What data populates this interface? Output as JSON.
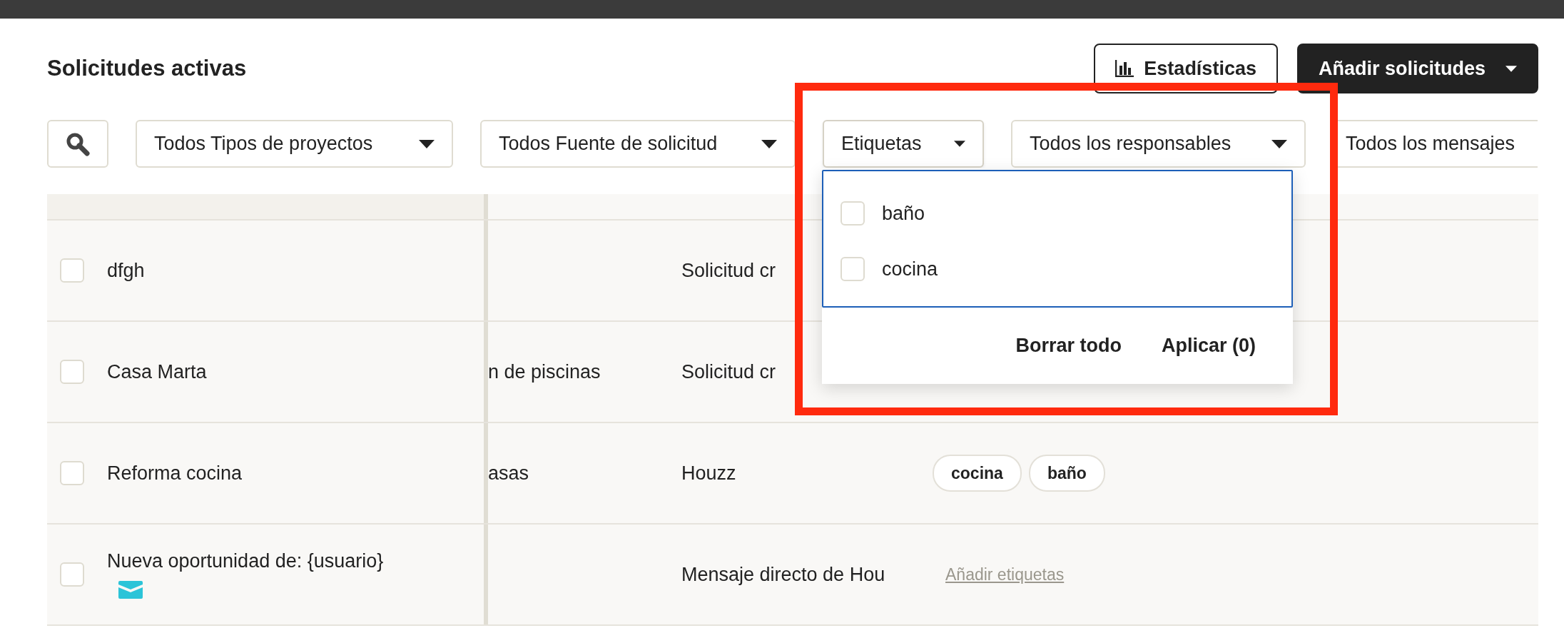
{
  "header": {
    "title": "Solicitudes activas",
    "buttons": [
      {
        "kind": "outline",
        "label": "Estadísticas"
      },
      {
        "kind": "dark",
        "label": "Añadir solicitudes"
      }
    ]
  },
  "filters": [
    {
      "kind": "search"
    },
    {
      "kind": "select",
      "label": "Todos Tipos de proyectos",
      "open": false
    },
    {
      "kind": "select",
      "label": "Todos Fuente de solicitud",
      "open": false
    },
    {
      "kind": "select",
      "label": "Etiquetas",
      "open": true
    },
    {
      "kind": "select",
      "label": "Todos los responsables",
      "open": false
    },
    {
      "kind": "cut",
      "label": "Todos los mensajes"
    }
  ],
  "tag_dropdown": {
    "options": [
      {
        "label": "baño",
        "checked": false
      },
      {
        "label": "cocina",
        "checked": false
      }
    ],
    "actions": [
      "Borrar todo",
      "Aplicar (0)"
    ]
  },
  "table": {
    "rows": [
      {
        "name": "dfgh",
        "checked": false,
        "unread_mail": false,
        "column_3": "Solicitud cr",
        "tags": []
      },
      {
        "name": "Casa Marta",
        "checked": false,
        "unread_mail": false,
        "column_2": "n de piscinas",
        "column_3": "Solicitud cr",
        "tags": []
      },
      {
        "name": "Reforma cocina",
        "checked": false,
        "unread_mail": false,
        "column_2": "asas",
        "column_3": "Houzz",
        "tags": [
          "cocina",
          "baño"
        ]
      },
      {
        "name": "Nueva oportunidad de: {usuario}",
        "checked": false,
        "unread_mail": true,
        "column_3": "Mensaje directo de Hou",
        "add_tags_link": "Añadir etiquetas",
        "tags": []
      }
    ]
  }
}
